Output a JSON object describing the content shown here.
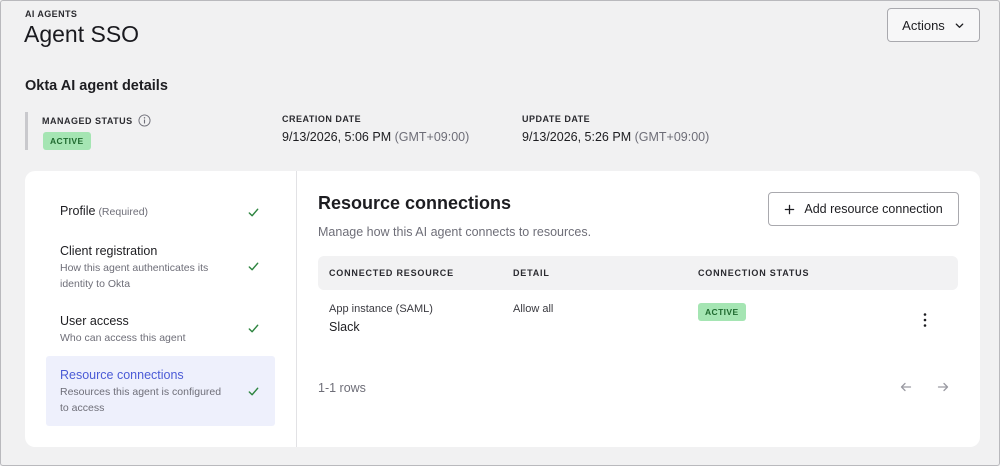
{
  "header": {
    "eyebrow": "AI AGENTS",
    "title": "Agent SSO",
    "actions_label": "Actions"
  },
  "details": {
    "section_title": "Okta AI agent details",
    "managed_status": {
      "label": "MANAGED STATUS",
      "value": "ACTIVE"
    },
    "creation_date": {
      "label": "CREATION DATE",
      "value": "9/13/2026, 5:06 PM",
      "tz": "(GMT+09:00)"
    },
    "update_date": {
      "label": "UPDATE DATE",
      "value": "9/13/2026, 5:26 PM",
      "tz": "(GMT+09:00)"
    }
  },
  "nav": {
    "items": [
      {
        "title": "Profile",
        "tag": "(Required)",
        "desc": "",
        "done": true
      },
      {
        "title": "Client registration",
        "desc": "How this agent authenticates its identity to Okta",
        "done": true
      },
      {
        "title": "User access",
        "desc": "Who can access this agent",
        "done": true
      },
      {
        "title": "Resource connections",
        "desc": "Resources this agent is configured to access",
        "done": true,
        "active": true
      }
    ]
  },
  "panel": {
    "title": "Resource connections",
    "subtitle": "Manage how this AI agent connects to resources.",
    "add_label": "Add resource connection",
    "columns": [
      "CONNECTED RESOURCE",
      "DETAIL",
      "CONNECTION STATUS"
    ],
    "rows": [
      {
        "resource_type": "App instance (SAML)",
        "resource_name": "Slack",
        "detail": "Allow all",
        "status": "ACTIVE"
      }
    ],
    "rows_count": "1-1 rows"
  },
  "colors": {
    "accent": "#4b5bd6",
    "active_badge_bg": "#a5e5b3",
    "active_badge_text": "#1f6a2f",
    "check": "#2e8540"
  },
  "icons": {
    "actions": "chevron-down-icon",
    "managed_status_info": "info-icon",
    "nav_done": "check-icon",
    "add": "plus-icon",
    "row_menu": "kebab-menu-icon",
    "prev": "arrow-left-icon",
    "next": "arrow-right-icon"
  }
}
